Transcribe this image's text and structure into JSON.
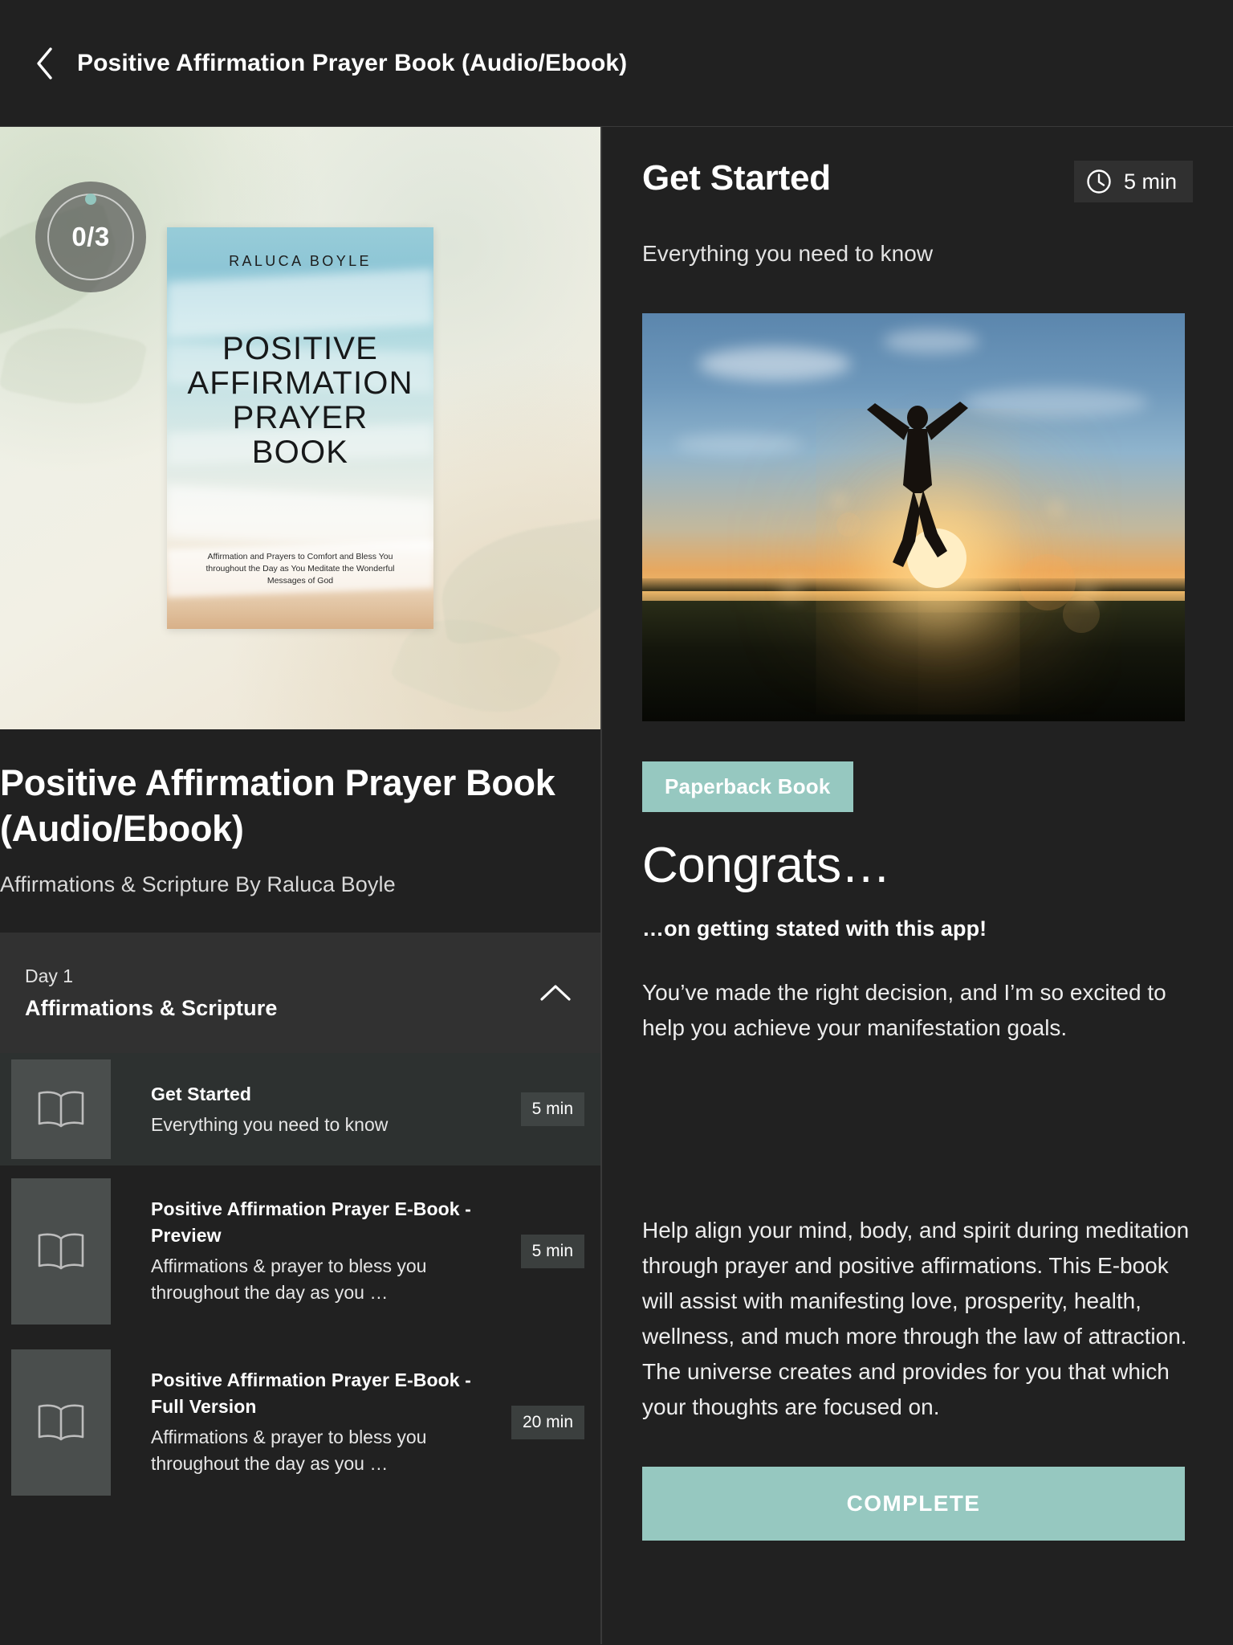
{
  "header": {
    "title": "Positive Affirmation Prayer Book (Audio/Ebook)",
    "back_icon": "chevron-left-icon"
  },
  "left": {
    "progress": {
      "label": "0/3",
      "completed": 0,
      "total": 3,
      "dot_color": "#93c6be"
    },
    "cover": {
      "author": "RALUCA  BOYLE",
      "title": "POSITIVE\nAFFIRMATION\nPRAYER\nBOOK",
      "subtitle": "Affirmation and Prayers to Comfort and Bless You throughout the Day as You Meditate the Wonderful Messages of God"
    },
    "course_title": "Positive Affirmation Prayer Book (Audio/Ebook)",
    "course_subtitle": "Affirmations & Scripture By Raluca Boyle",
    "accordion": {
      "day_label": "Day 1",
      "section_title": "Affirmations & Scripture",
      "chevron_icon": "chevron-up-icon",
      "expanded": true
    },
    "lessons": [
      {
        "icon": "open-book-icon",
        "title": "Get Started",
        "description": "Everything you need to know",
        "duration": "5 min",
        "active": true
      },
      {
        "icon": "open-book-icon",
        "title": "Positive Affirmation Prayer E-Book - Preview",
        "description": "Affirmations & prayer to bless you throughout the day as you …",
        "duration": "5 min",
        "active": false
      },
      {
        "icon": "open-book-icon",
        "title": "Positive Affirmation Prayer E-Book - Full Version",
        "description": "Affirmations & prayer to bless you throughout the day as you …",
        "duration": "20 min",
        "active": false
      }
    ]
  },
  "right": {
    "title": "Get Started",
    "duration": "5 min",
    "clock_icon": "clock-icon",
    "subtitle": "Everything you need to know",
    "hero_image_alt": "person jumping in a field at sunset",
    "tag": "Paperback Book",
    "tag_color": "#96c8c0",
    "heading": "Congrats…",
    "lead": "…on getting stated with this app!",
    "paragraph_1": "You’ve made the right decision, and I’m so excited to help you achieve your manifestation goals.",
    "paragraph_2": "Help align your mind, body, and spirit during meditation through prayer and positive affirmations. This E-book will assist with manifesting love, prosperity, health, wellness, and much more through the law of attraction. The universe creates and provides for you that which your thoughts are focused on.",
    "complete_button": "COMPLETE"
  },
  "theme": {
    "background": "#212121",
    "panel": "#313131",
    "accent": "#96c8c0",
    "text": "#ffffff"
  }
}
